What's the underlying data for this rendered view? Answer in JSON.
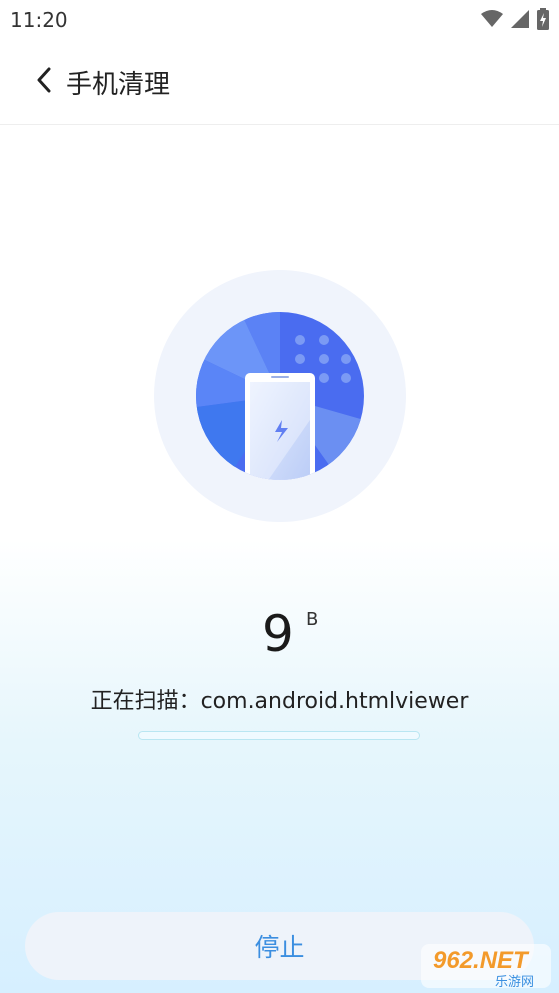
{
  "status_bar": {
    "time": "11:20"
  },
  "header": {
    "title": "手机清理"
  },
  "scan": {
    "size_value": "9",
    "size_unit": "B",
    "label": "正在扫描：com.android.htmlviewer",
    "progress": 0
  },
  "actions": {
    "stop_label": "停止"
  },
  "watermark": {
    "text_top": "962.NET",
    "text_bottom": "乐游网"
  },
  "colors": {
    "accent": "#3b8ee0",
    "circle_blue": "#4a6cf0",
    "button_bg": "#eef3fa"
  }
}
